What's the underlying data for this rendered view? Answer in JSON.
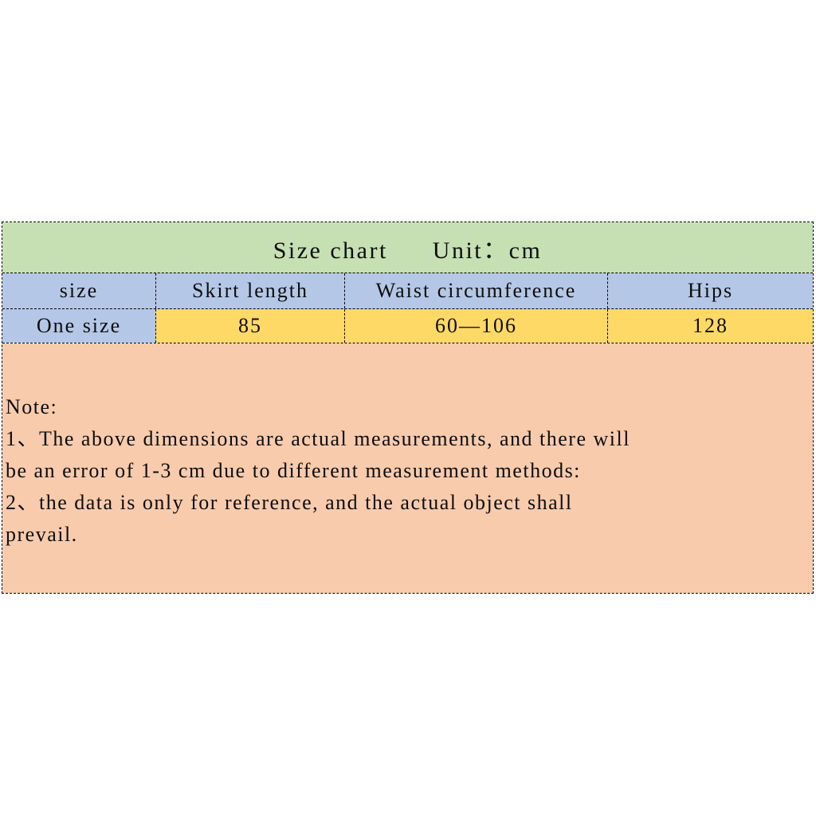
{
  "chart_data": {
    "type": "table",
    "title": "Size chart",
    "unit_label": "Unit：cm",
    "columns": [
      "size",
      "Skirt length",
      "Waist circumference",
      "Hips"
    ],
    "rows": [
      [
        "One size",
        "85",
        "60—106",
        "128"
      ]
    ],
    "note_heading": "Note:",
    "notes": [
      "1、The above dimensions are actual measurements, and there will",
      "be an error of 1-3 cm due to different measurement methods:",
      "2、the data is only for reference, and the actual object shall",
      "prevail."
    ],
    "colors": {
      "title_bg": "#C6E0B4",
      "header_bg": "#B4C7E7",
      "value_bg": "#FFD966",
      "note_bg": "#F8CBAD",
      "border": "#000000",
      "text": "#0D0D0D"
    }
  },
  "table": {
    "title": "Size chart",
    "unit": "Unit：cm",
    "headers": {
      "size": "size",
      "skirt_length": "Skirt length",
      "waist_circumference": "Waist circumference",
      "hips": "Hips"
    },
    "data_row": {
      "size": "One size",
      "skirt_length": "85",
      "waist_circumference": "60—106",
      "hips": "128"
    }
  },
  "note": {
    "heading": "Note:",
    "line1": "1、The above dimensions are actual measurements, and there will",
    "line2": "be an error of 1-3 cm due to different measurement methods:",
    "line3": "2、the data is only for reference, and the actual object shall",
    "line4": "prevail."
  }
}
